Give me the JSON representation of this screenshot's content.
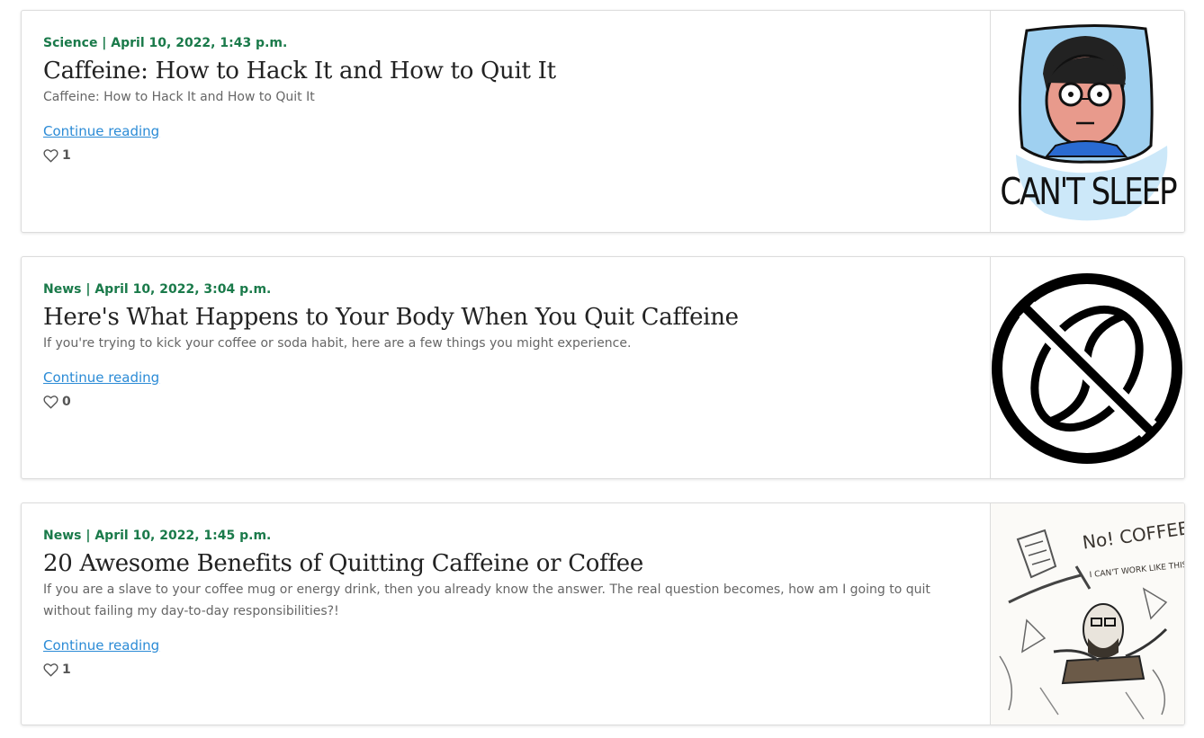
{
  "posts": [
    {
      "meta": "Science | April 10, 2022, 1:43 p.m.",
      "title": "Caffeine: How to Hack It and How to Quit It",
      "excerpt": "Caffeine: How to Hack It and How to Quit It",
      "link_label": "Continue reading",
      "likes": "1",
      "image_caption": "CAN'T SLEEP"
    },
    {
      "meta": "News | April 10, 2022, 3:04 p.m.",
      "title": "Here's What Happens to Your Body When You Quit Caffeine",
      "excerpt": "If you're trying to kick your coffee or soda habit, here are a few things you might experience.",
      "link_label": "Continue reading",
      "likes": "0"
    },
    {
      "meta": "News | April 10, 2022, 1:45 p.m.",
      "title": "20 Awesome Benefits of Quitting Caffeine or Coffee",
      "excerpt": "If you are a slave to your coffee mug or energy drink, then you already know the answer. The real question becomes, how am I going to quit without failing my day-to-day responsibilities?!",
      "link_label": "Continue reading",
      "likes": "1",
      "image_caption_1": "No! COFFEE!",
      "image_caption_2": "I CAN'T WORK LIKE THIS!"
    }
  ],
  "colors": {
    "meta_green": "#1a7a4a",
    "link_blue": "#2b8bd6",
    "pillow_blue": "#9fd0f0"
  }
}
